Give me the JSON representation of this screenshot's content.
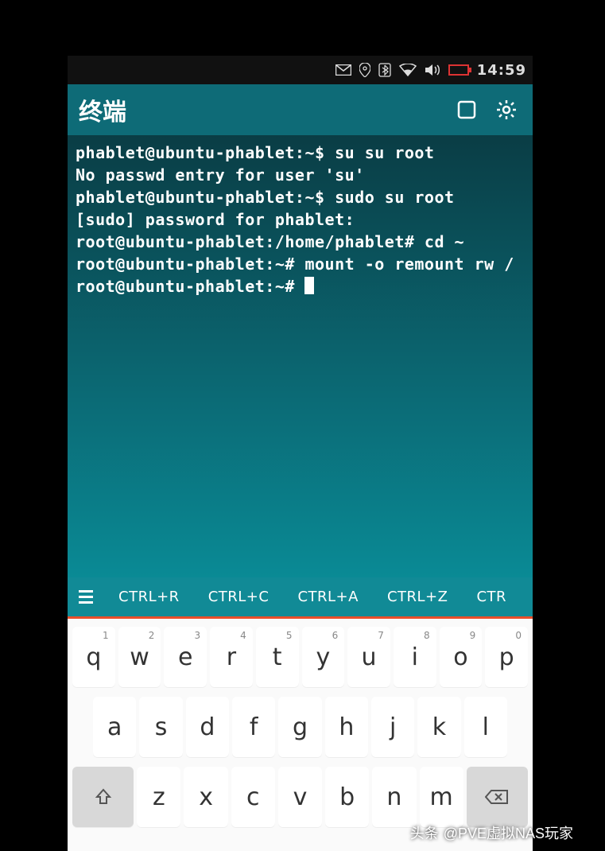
{
  "statusbar": {
    "time": "14:59"
  },
  "titlebar": {
    "title": "终端"
  },
  "terminal": {
    "lines": [
      "phablet@ubuntu-phablet:~$ su su root",
      "No passwd entry for user 'su'",
      "phablet@ubuntu-phablet:~$ sudo su root",
      "[sudo] password for phablet:",
      "root@ubuntu-phablet:/home/phablet# cd ~",
      "root@ubuntu-phablet:~# mount -o remount rw /",
      "root@ubuntu-phablet:~# "
    ]
  },
  "shortcuts": {
    "items": [
      "CTRL+R",
      "CTRL+C",
      "CTRL+A",
      "CTRL+Z",
      "CTR"
    ]
  },
  "keyboard": {
    "row1": [
      {
        "label": "q",
        "num": "1"
      },
      {
        "label": "w",
        "num": "2"
      },
      {
        "label": "e",
        "num": "3"
      },
      {
        "label": "r",
        "num": "4"
      },
      {
        "label": "t",
        "num": "5"
      },
      {
        "label": "y",
        "num": "6"
      },
      {
        "label": "u",
        "num": "7"
      },
      {
        "label": "i",
        "num": "8"
      },
      {
        "label": "o",
        "num": "9"
      },
      {
        "label": "p",
        "num": "0"
      }
    ],
    "row2": [
      {
        "label": "a"
      },
      {
        "label": "s"
      },
      {
        "label": "d"
      },
      {
        "label": "f"
      },
      {
        "label": "g"
      },
      {
        "label": "h"
      },
      {
        "label": "j"
      },
      {
        "label": "k"
      },
      {
        "label": "l"
      }
    ],
    "row3": [
      {
        "label": "z"
      },
      {
        "label": "x"
      },
      {
        "label": "c"
      },
      {
        "label": "v"
      },
      {
        "label": "b"
      },
      {
        "label": "n"
      },
      {
        "label": "m"
      }
    ]
  },
  "watermark": {
    "prefix": "头条",
    "text": "@PVE虚拟NAS玩家"
  }
}
